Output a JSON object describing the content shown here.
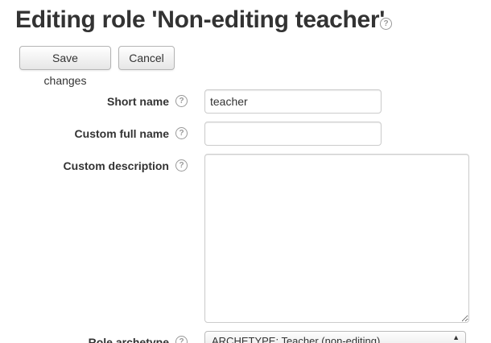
{
  "header": {
    "title": "Editing role 'Non-editing teacher'",
    "help_icon": "question-circle-icon"
  },
  "actions": {
    "save_label": "Save changes",
    "cancel_label": "Cancel"
  },
  "form": {
    "short_name": {
      "label": "Short name",
      "value": "teacher",
      "help_icon": "question-circle-icon"
    },
    "custom_full_name": {
      "label": "Custom full name",
      "value": "",
      "help_icon": "question-circle-icon"
    },
    "custom_description": {
      "label": "Custom description",
      "value": "",
      "help_icon": "question-circle-icon"
    },
    "role_archetype": {
      "label": "Role archetype",
      "selected": "ARCHETYPE: Teacher (non-editing)",
      "help_icon": "question-circle-icon"
    }
  },
  "icons": {
    "help_glyph": "?",
    "select_arrows": "▲"
  },
  "colors": {
    "text": "#333333",
    "icon": "#999999",
    "input_border": "#cccccc"
  }
}
